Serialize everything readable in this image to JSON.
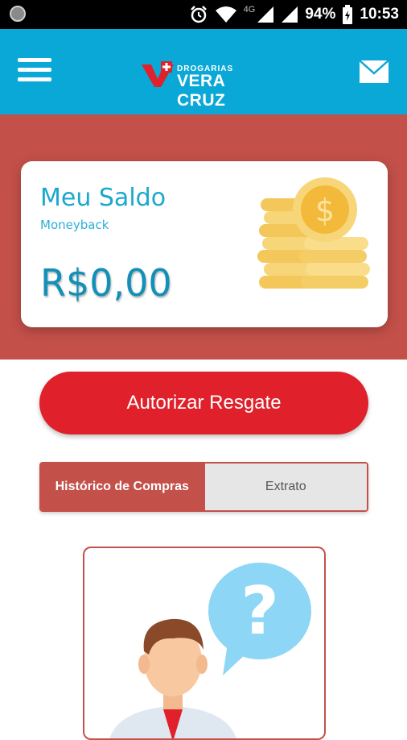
{
  "status_bar": {
    "network": "4G",
    "battery": "94%",
    "time": "10:53"
  },
  "app_bar": {
    "logo_small": "DROGARIAS",
    "logo_big": "VERA CRUZ",
    "menu_icon": "hamburger-menu-icon",
    "mail_icon": "mail-icon"
  },
  "balance_card": {
    "title": "Meu Saldo",
    "subtitle": "Moneyback",
    "value": "R$0,00",
    "illustration": "coins-stack-icon"
  },
  "actions": {
    "redeem_label": "Autorizar Resgate"
  },
  "tabs": [
    {
      "label": "Histórico de Compras",
      "active": true
    },
    {
      "label": "Extrato",
      "active": false
    }
  ],
  "empty_state": {
    "illustration": "person-question-icon"
  },
  "colors": {
    "header_blue": "#0aa8d6",
    "brand_red": "#c4504a",
    "button_red": "#e0202a",
    "accent_cyan": "#1ba8cf"
  }
}
